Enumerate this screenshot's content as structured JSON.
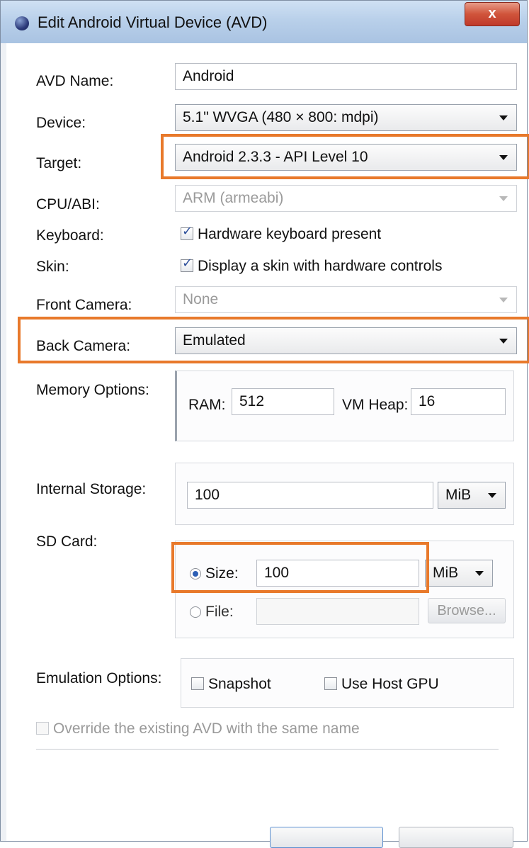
{
  "window": {
    "title": "Edit Android Virtual Device (AVD)",
    "close_label": "x"
  },
  "form": {
    "avd_name": {
      "label": "AVD Name:",
      "value": "Android"
    },
    "device": {
      "label": "Device:",
      "value": "5.1\" WVGA (480 × 800: mdpi)"
    },
    "target": {
      "label": "Target:",
      "value": "Android 2.3.3 - API Level 10"
    },
    "cpu_abi": {
      "label": "CPU/ABI:",
      "value": "ARM (armeabi)"
    },
    "keyboard": {
      "label": "Keyboard:",
      "checkbox_label": "Hardware keyboard present",
      "checked": true
    },
    "skin": {
      "label": "Skin:",
      "checkbox_label": "Display a skin with hardware controls",
      "checked": true
    },
    "front_camera": {
      "label": "Front Camera:",
      "value": "None"
    },
    "back_camera": {
      "label": "Back Camera:",
      "value": "Emulated"
    },
    "memory": {
      "label": "Memory Options:",
      "ram_label": "RAM:",
      "ram_value": "512",
      "vm_heap_label": "VM Heap:",
      "vm_heap_value": "16"
    },
    "internal_storage": {
      "label": "Internal Storage:",
      "value": "100",
      "unit": "MiB"
    },
    "sd_card": {
      "label": "SD Card:",
      "size_label": "Size:",
      "size_value": "100",
      "size_unit": "MiB",
      "size_selected": true,
      "file_label": "File:",
      "file_value": "",
      "browse_label": "Browse..."
    },
    "emulation": {
      "label": "Emulation Options:",
      "snapshot_label": "Snapshot",
      "snapshot_checked": false,
      "host_gpu_label": "Use Host GPU",
      "host_gpu_checked": false
    },
    "override": {
      "label": "Override the existing AVD with the same name",
      "checked": false
    }
  },
  "highlight_color": "#e8792b"
}
